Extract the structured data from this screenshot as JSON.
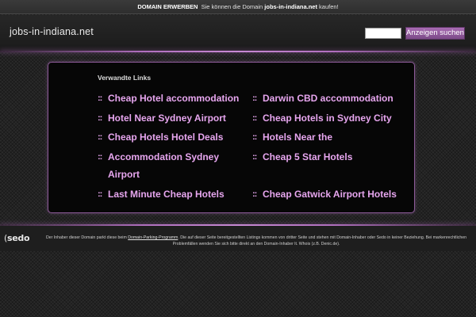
{
  "topbar": {
    "label": "DOMAIN ERWERBEN",
    "text_before": "Sie können die Domain",
    "domain": "jobs-in-indiana.net",
    "text_after": "kaufen!"
  },
  "header": {
    "site_title": "jobs-in-indiana.net",
    "search_value": "",
    "search_button": "Anzeigen suchen"
  },
  "related": {
    "title": "Verwandte Links",
    "bullet": "::",
    "left": [
      {
        "label": "Cheap Hotel accommodation"
      },
      {
        "label": "Hotel Near Sydney Airport"
      },
      {
        "label": "Cheap Hotels Hotel Deals"
      },
      {
        "label": "Accommodation Sydney",
        "label2": "Airport"
      },
      {
        "label": "Last Minute Cheap Hotels"
      }
    ],
    "right": [
      {
        "label": "Darwin CBD accommodation"
      },
      {
        "label": "Cheap Hotels in Sydney City"
      },
      {
        "label": "Hotels Near the"
      },
      {
        "label": "Cheap 5 Star Hotels"
      },
      {
        "label": "Cheap Gatwick Airport Hotels"
      }
    ]
  },
  "footer": {
    "logo": "sedo",
    "text_1": "Der Inhaber dieser Domain parkt diese beim",
    "program_link": "Domain-Parking-Programm",
    "text_2": ". Die auf dieser Seite bereitgestellten Listings kommen von dritter Seite und stehen mit Domain-Inhaber oder Sedo in keiner Beziehung. Bei markenrechtlichen Problemfällen wenden Sie sich bitte direkt an den Domain-Inhaber lt. Whois (z.B. Denic.de)."
  }
}
